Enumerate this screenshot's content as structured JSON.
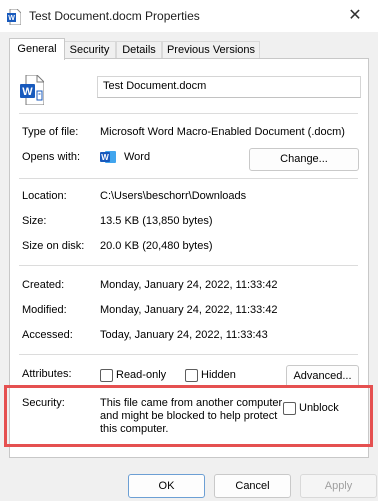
{
  "window": {
    "title": "Test Document.docm Properties",
    "close_glyph": "✕",
    "title_icon": "word-doc-icon"
  },
  "tabs": [
    {
      "label": "General",
      "active": true
    },
    {
      "label": "Security",
      "active": false
    },
    {
      "label": "Details",
      "active": false
    },
    {
      "label": "Previous Versions",
      "active": false
    }
  ],
  "general": {
    "file_name": "Test Document.docm",
    "type_label": "Type of file:",
    "type_value": "Microsoft Word Macro-Enabled Document (.docm)",
    "opens_label": "Opens with:",
    "opens_value": "Word",
    "change_button": "Change...",
    "location_label": "Location:",
    "location_value": "C:\\Users\\beschorr\\Downloads",
    "size_label": "Size:",
    "size_value": "13.5 KB (13,850 bytes)",
    "size_on_disk_label": "Size on disk:",
    "size_on_disk_value": "20.0 KB (20,480 bytes)",
    "created_label": "Created:",
    "created_value": "Monday, January 24, 2022, 11:33:42",
    "modified_label": "Modified:",
    "modified_value": "Monday, January 24, 2022, 11:33:42",
    "accessed_label": "Accessed:",
    "accessed_value": "Today, January 24, 2022, 11:33:43",
    "attributes_label": "Attributes:",
    "readonly_label": "Read-only",
    "readonly_checked": false,
    "hidden_label": "Hidden",
    "hidden_checked": false,
    "advanced_button": "Advanced...",
    "security_label": "Security:",
    "security_text": "This file came from another computer and might be blocked to help protect this computer.",
    "unblock_label": "Unblock",
    "unblock_checked": false
  },
  "footer": {
    "ok": "OK",
    "cancel": "Cancel",
    "apply": "Apply"
  },
  "colors": {
    "highlight": "#e55050",
    "word_blue": "#185abd"
  }
}
